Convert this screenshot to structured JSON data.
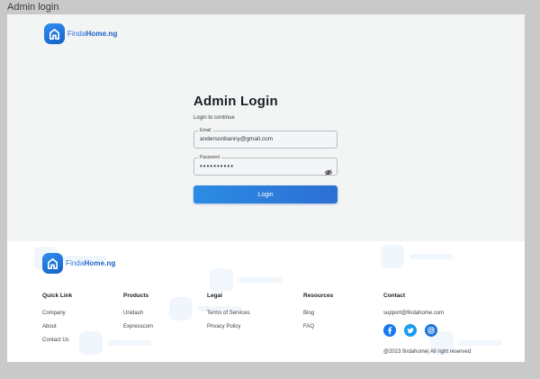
{
  "window": {
    "title": "Admin login"
  },
  "brand": {
    "name_light": "Finda",
    "name_bold": "Home.ng",
    "color": "#1d6fd8"
  },
  "login": {
    "title": "Admin Login",
    "subtitle": "Login to continue",
    "email_label": "Email",
    "email_value": "andersonbanny@gmail.com",
    "password_label": "Password",
    "password_value": "••••••••••",
    "submit_label": "Login",
    "button_color": "#2b7fdf"
  },
  "footer": {
    "columns": [
      {
        "heading": "Quick Link",
        "links": [
          "Company",
          "About",
          "Contact Us"
        ]
      },
      {
        "heading": "Products",
        "links": [
          "Unidash",
          "Expresscom"
        ]
      },
      {
        "heading": "Legal",
        "links": [
          "Terms of Services",
          "Privacy Policy"
        ]
      },
      {
        "heading": "Resources",
        "links": [
          "Blog",
          "FAQ"
        ]
      },
      {
        "heading": "Contact",
        "links": [
          "support@findahome.com"
        ]
      }
    ],
    "social": [
      "facebook-icon",
      "twitter-icon",
      "instagram-icon"
    ],
    "copyright": "@2023 findahome| All right reserved"
  }
}
